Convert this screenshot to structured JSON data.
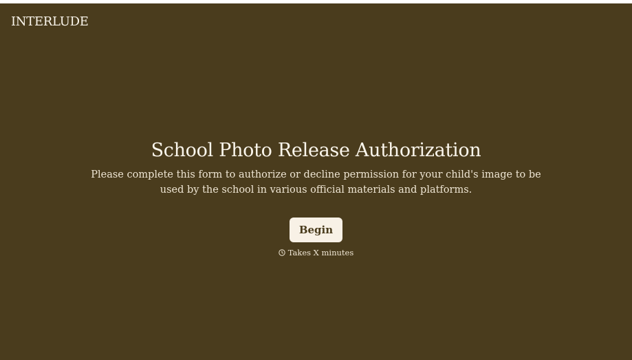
{
  "brand": {
    "name": "INTERLUDE"
  },
  "hero": {
    "title": "School Photo Release Authorization",
    "description": "Please complete this form to authorize or decline permission for your child's image to be used by the school in various official materials and platforms.",
    "cta_label": "Begin",
    "duration_text": "Takes X minutes",
    "duration_icon": "clock-icon"
  },
  "colors": {
    "background": "#4a3c1d",
    "button_bg": "#f8f1e6",
    "text": "#fbf6ec"
  }
}
